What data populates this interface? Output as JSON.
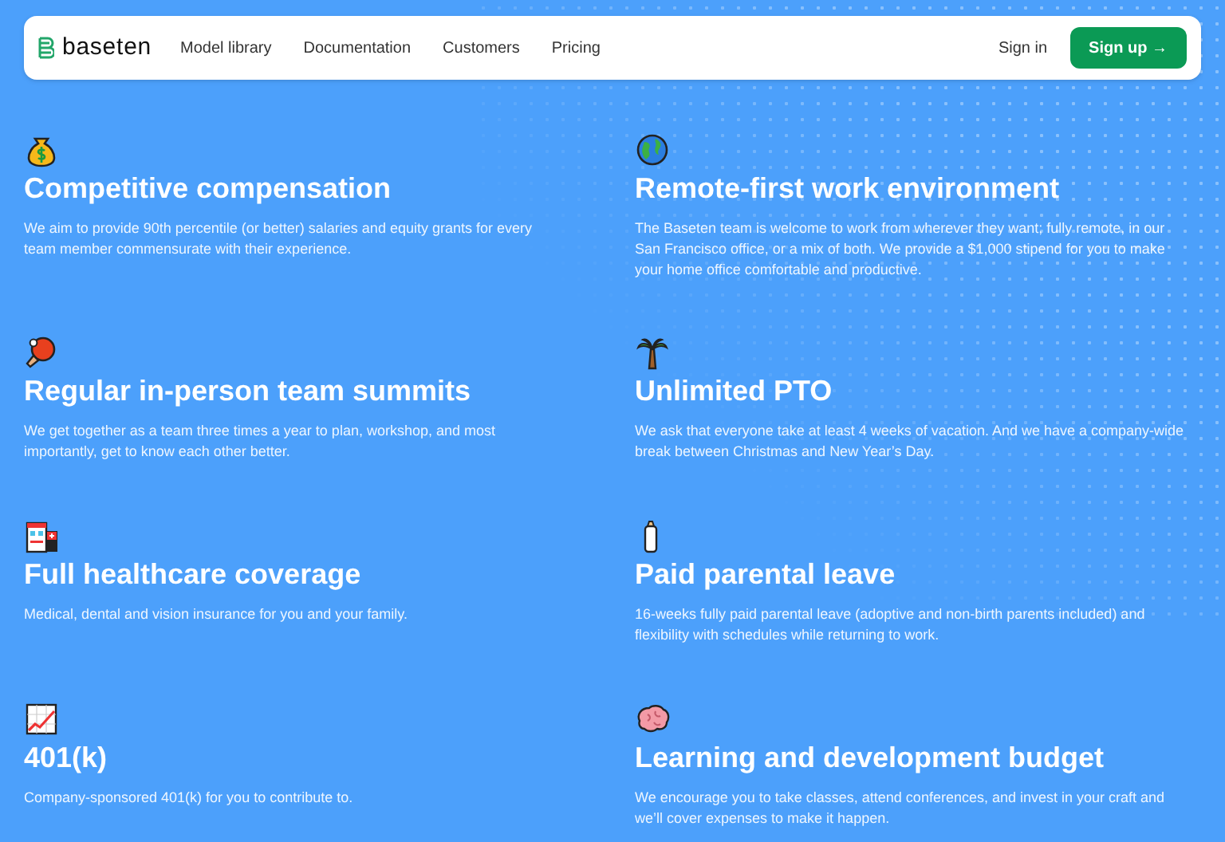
{
  "nav": {
    "brand": "baseten",
    "links": [
      "Model library",
      "Documentation",
      "Customers",
      "Pricing"
    ],
    "sign_in": "Sign in",
    "sign_up": "Sign up →"
  },
  "benefits": [
    {
      "title": "Competitive compensation",
      "text": "We aim to provide 90th percentile (or better) salaries and equity grants for every team member commensurate with their experience."
    },
    {
      "title": "Remote-first work environment",
      "text": "The Baseten team is welcome to work from wherever they want; fully remote, in our San Francisco office, or a mix of both. We provide a $1,000 stipend for you to make your home office comfortable and productive."
    },
    {
      "title": "Regular in-person team summits",
      "text": "We get together as a team three times a year to plan, workshop, and most importantly, get to know each other better."
    },
    {
      "title": "Unlimited PTO",
      "text": "We ask that everyone take at least 4 weeks of vacation. And we have a company-wide break between Christmas and New Year’s Day."
    },
    {
      "title": "Full healthcare coverage",
      "text": "Medical, dental and vision insurance for you and your family."
    },
    {
      "title": "Paid parental leave",
      "text": "16-weeks fully paid parental leave (adoptive and non-birth parents included) and flexibility with schedules while returning to work."
    },
    {
      "title": "401(k)",
      "text": "Company-sponsored 401(k) for you to contribute to."
    },
    {
      "title": "Learning and development budget",
      "text": "We encourage you to take classes, attend conferences, and invest in your craft and we’ll cover expenses to make it happen."
    }
  ]
}
